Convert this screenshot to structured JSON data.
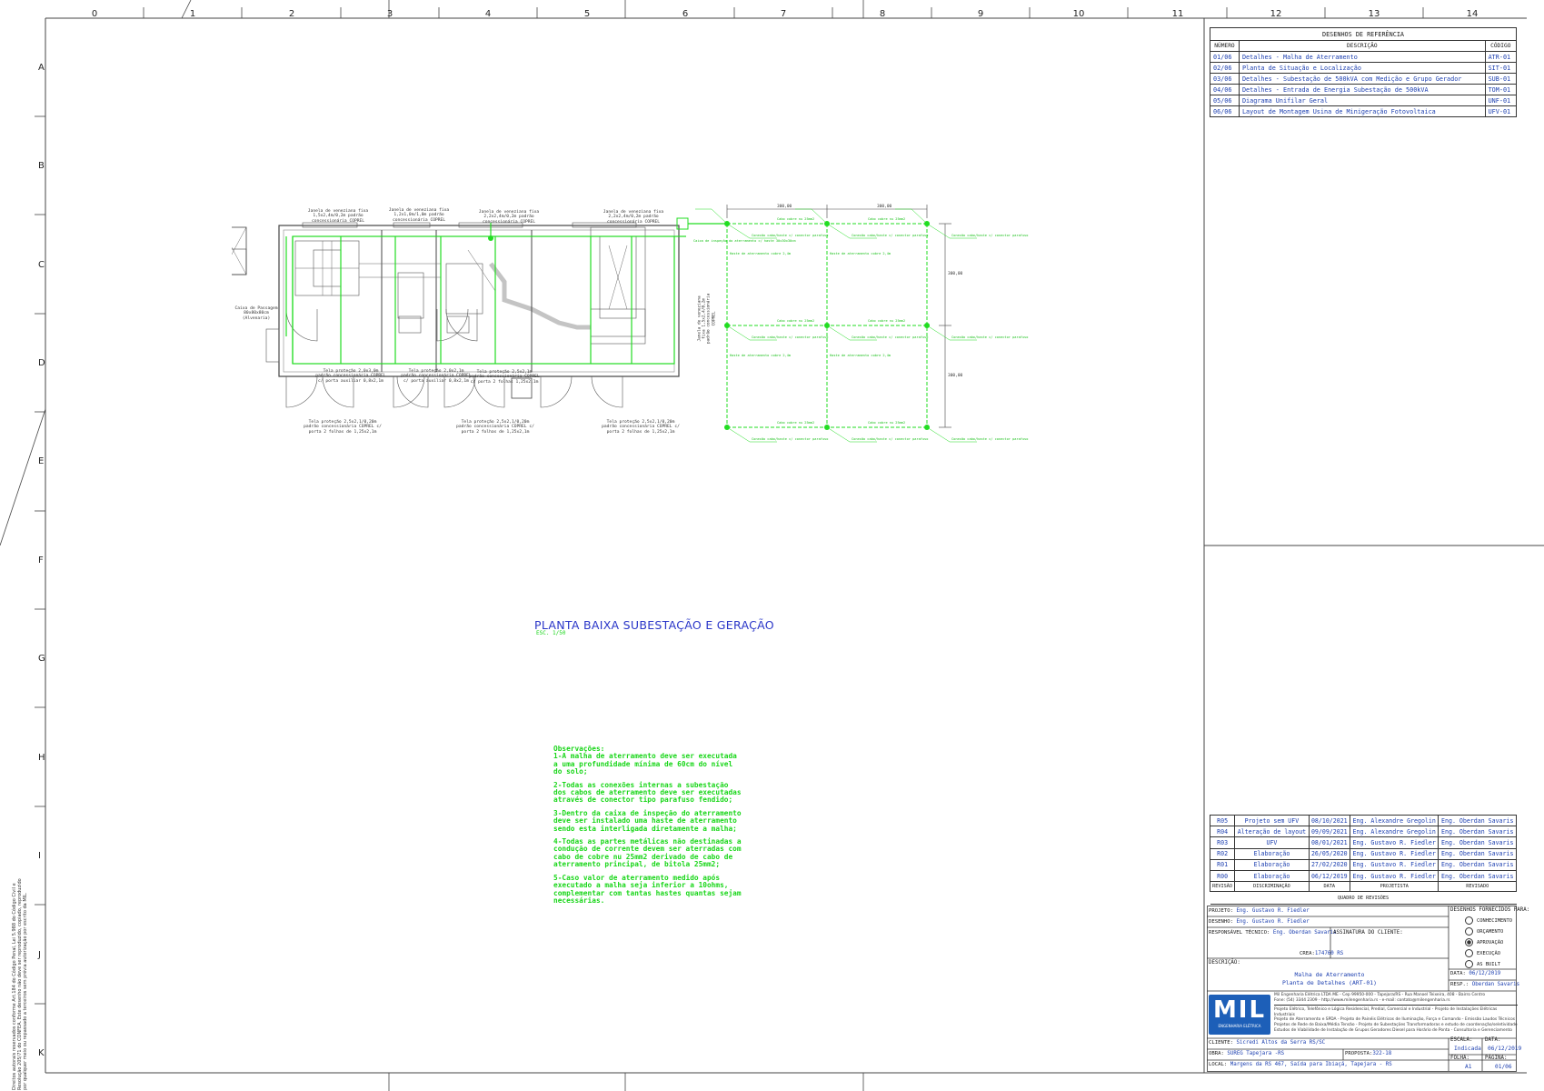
{
  "columns": [
    "0",
    "1",
    "2",
    "3",
    "4",
    "5",
    "6",
    "7",
    "8",
    "9",
    "10",
    "11",
    "12",
    "13",
    "14"
  ],
  "rows": [
    "A",
    "B",
    "C",
    "D",
    "E",
    "F",
    "G",
    "H",
    "I",
    "J",
    "K"
  ],
  "copyright": "Direitos autorais reservados conforme Art.184 do Código Penal, Lei 5.988 do Código Civil e Resolução 205/71 do CONFEA. Este desenho não deve ser reproduzido, copiado, reproduzido por qualquer meio ou repassado a terceiros sem prévia autorização por escrito da MIL.",
  "ref_drawings": {
    "title": "DESENHOS DE REFERÊNCIA",
    "headers": [
      "NÚMERO",
      "DESCRIÇÃO",
      "CÓDIGO"
    ],
    "rows": [
      {
        "num": "01/06",
        "desc": "Detalhes - Malha de Aterramento",
        "code": "ATR-01"
      },
      {
        "num": "02/06",
        "desc": "Planta de Situação e Localização",
        "code": "SIT-01"
      },
      {
        "num": "03/06",
        "desc": "Detalhes - Subestação de 500kVA com Medição e Grupo Gerador",
        "code": "SUB-01"
      },
      {
        "num": "04/06",
        "desc": "Detalhes - Entrada de Energia Subestação de 500kVA",
        "code": "TOM-01"
      },
      {
        "num": "05/06",
        "desc": "Diagrama Unifilar Geral",
        "code": "UNF-01"
      },
      {
        "num": "06/06",
        "desc": "Layout de Montagem Usina de Minigeração Fotovoltaica",
        "code": "UFV-01"
      }
    ]
  },
  "drawing": {
    "title": "PLANTA BAIXA SUBESTAÇÃO E GERAÇÃO",
    "scale": "ESC. 1/50",
    "window_labels": [
      "Janela de veneziana fixa 1,5x2,4m/0,2m padrão concessionária COPREL",
      "Janela de veneziana fixa 1,2x1,0m/1,0m padrão concessionária COPREL",
      "Janela de veneziana fixa 2,2x2,4m/0,2m padrão concessionária COPREL",
      "Janela de veneziana fixa 2,2x2,4m/0,2m padrão concessionária COPREL"
    ],
    "screen_labels": [
      "Tela proteção 2,0x3,0m padrão concessionária COPREL c/ porta auxiliar 0,8x2,1m",
      "Tela proteção 2,0x2,1m padrão concessionária COPREL c/ porta auxiliar 0,8x2,1m",
      "Tela proteção 2,5x2,1m padrão concessionária COPREL c/ porta 2 folhas 1,25x2,1m"
    ],
    "bottom_labels": [
      "Tela proteção 2,5x2,1/0,20m padrão concessionária COPREL c/ porta 2 folhas de 1,25x2,1m",
      "Tela proteção 2,5x2,1/0,20m padrão concessionária COPREL c/ porta 2 folhas de 1,25x2,1m",
      "Tela proteção 2,5x2,1/0,20m padrão concessionária COPREL c/ porta 2 folhas de 1,25x2,1m"
    ],
    "pass_box": "Caixa de Passagem 80x80x80cm (Alvenaria)",
    "side_window": "Janela de veneziana fixa 1,5x2,4/0,2m padrão concessionária COPREL",
    "inspection_box": "Caixa de inspeção do aterramento c/ haste 30x30x30cm",
    "dim_top": [
      "300,00",
      "300,00"
    ],
    "dim_side": [
      "300,00",
      "300,00"
    ],
    "rod_label": "Haste de aterramento cobre 2,4m",
    "cable_label": "Cabo cobre nu 25mm2",
    "grid_label": "Conexão cabo/haste c/ conector parafuso"
  },
  "notes": {
    "title": "Observações:",
    "items": [
      "1-A malha de aterramento deve ser executada a uma profundidade mínima de 60cm do nível do solo;",
      "2-Todas as conexões internas a subestação dos cabos de aterramento deve ser executadas através de conector tipo parafuso fendido;",
      "3-Dentro da caixa de inspeção do aterramento deve ser instalado uma haste de aterramento sendo esta interligada diretamente a malha;",
      "4-Todas as partes metálicas não destinadas a condução de corrente devem ser aterradas com cabo de cobre nu 25mm2 derivado de cabo de aterramento principal, de bitola 25mm2;",
      "5-Caso valor de aterramento medido após executado a malha seja inferior a 10ohms, complementar com tantas hastes quantas sejam necessárias."
    ]
  },
  "revisions": {
    "title": "QUADRO DE REVISÕES",
    "headers": [
      "REVISÃO",
      "DISCRIMINAÇÃO",
      "DATA",
      "PROJETISTA",
      "REVISADO"
    ],
    "rows": [
      {
        "rev": "R05",
        "desc": "Projeto sem UFV",
        "date": "08/10/2021",
        "designer": "Eng. Alexandre Gregolin",
        "reviewer": "Eng. Oberdan Savaris"
      },
      {
        "rev": "R04",
        "desc": "Alteração de layout",
        "date": "09/09/2021",
        "designer": "Eng. Alexandre Gregolin",
        "reviewer": "Eng. Oberdan Savaris"
      },
      {
        "rev": "R03",
        "desc": "UFV",
        "date": "08/01/2021",
        "designer": "Eng. Gustavo R. Fiedler",
        "reviewer": "Eng. Oberdan Savaris"
      },
      {
        "rev": "R02",
        "desc": "Elaboração",
        "date": "26/05/2020",
        "designer": "Eng. Gustavo R. Fiedler",
        "reviewer": "Eng. Oberdan Savaris"
      },
      {
        "rev": "R01",
        "desc": "Elaboração",
        "date": "27/02/2020",
        "designer": "Eng. Gustavo R. Fiedler",
        "reviewer": "Eng. Oberdan Savaris"
      },
      {
        "rev": "R00",
        "desc": "Elaboração",
        "date": "06/12/2019",
        "designer": "Eng. Gustavo R. Fiedler",
        "reviewer": "Eng. Oberdan Savaris"
      }
    ]
  },
  "titleblock": {
    "projeto_label": "PROJETO:",
    "projeto": "Eng. Gustavo R. Fiedler",
    "desenho_label": "DESENHO:",
    "desenho": "Eng. Gustavo R. Fiedler",
    "resp_label": "RESPONSÁVEL TÉCNICO:",
    "resp": "Eng. Oberdan Savaris",
    "assinatura_label": "ASSINATURA DO CLIENTE:",
    "crea_label": "CREA:",
    "crea": "174760 RS",
    "descricao_label": "DESCRIÇÃO:",
    "descricao_1": "Malha de Aterramento",
    "descricao_2": "Planta de Detalhes (ART-01)",
    "fornecidos_title": "DESENHOS FORNECIDOS PARA:",
    "options": [
      "CONHECIMENTO",
      "ORÇAMENTO",
      "APROVAÇÃO",
      "EXECUÇÃO",
      "AS BUILT"
    ],
    "selected_option": "APROVAÇÃO",
    "data_label": "DATA:",
    "data": "06/12/2019",
    "resp2_label": "RESP.:",
    "resp2": "Oberdan Savaris",
    "company_line1": "Mil Engenharia Elétrica LTDA ME - Cep 99950-000 - Tapejara/RS - Rua Manoel Teixeira, 408 - Bairro Centro",
    "company_line2": "Fone: (54) 3344 2309 - http://www.milengenharia.rs - e-mail: contato@milengenharia.rs",
    "services": [
      "Projeto Elétrico, Telefônico e Lógica Residencial, Predial, Comercial e Industrial - Projeto de Instalações Elétricas Industriais",
      "Projeto de Aterramento e SPDA - Projeto de Painéis Elétricos de Iluminação, Força e Comando - Emissão Laudos Técnicos",
      "Projetos de Rede de Baixa/Média Tensão - Projeto de Subestações Transformadoras e estudo de coordenação/seletividade",
      "Estudos de Viabilidade de Instalação de Grupos Geradores Diesel para Horário de Ponta - Consultoria e Gerenciamento"
    ],
    "logo_text": "MIL",
    "logo_sub": "ENGENHARIA ELÉTRICA",
    "cliente_label": "CLIENTE:",
    "cliente": "Sicredi Altos da Serra RS/SC",
    "obra_label": "OBRA:",
    "obra": "SUREG Tapejara -RS",
    "proposta_label": "PROPOSTA:",
    "proposta": "322-18",
    "local_label": "LOCAL:",
    "local": "Margens da RS 467, Saída para Ibiaçá, Tapejara - RS",
    "escala_label": "ESCALA:",
    "escala": "Indicada",
    "data2_label": "DATA:",
    "data2": "06/12/2019",
    "folha_label": "FOLHA:",
    "folha": "A1",
    "pagina_label": "PÁGINA:",
    "pagina": "01/06"
  }
}
